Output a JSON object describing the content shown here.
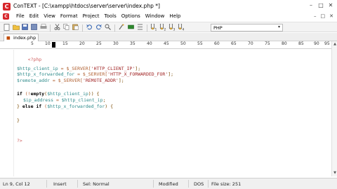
{
  "window": {
    "app_icon_letter": "C",
    "title": "ConTEXT - [C:\\xampp\\htdocs\\server\\server\\index.php *]",
    "controls": [
      "–",
      "□",
      "✕"
    ]
  },
  "menubar": {
    "items": [
      "File",
      "Edit",
      "View",
      "Format",
      "Project",
      "Tools",
      "Options",
      "Window",
      "Help"
    ],
    "doc_controls": [
      "–",
      "□",
      "✕"
    ]
  },
  "toolbar": {
    "language_value": "PHP",
    "language_arrow": "▾"
  },
  "tab": {
    "label": "index.php *"
  },
  "ruler": {
    "labels": [
      "5",
      "10",
      "15",
      "20",
      "25",
      "30",
      "35",
      "40",
      "45",
      "50",
      "55",
      "60",
      "65",
      "70",
      "75",
      "80",
      "85",
      "90",
      "95"
    ]
  },
  "code": {
    "l1": "<?php",
    "l3_var": "$http_client_ip",
    "l3_mid": " = $_SERVER[",
    "l3_str": "'HTTP_CLIENT_IP'",
    "l3_end": "];",
    "l4_var": "$http_x_forwarded_for",
    "l4_mid": " = $_SERVER[",
    "l4_str": "'HTTP_X_FORWARDED_FOR'",
    "l4_end": "];",
    "l5_var": "$remote_addr",
    "l5_mid": " = $_SERVER[",
    "l5_str": "'REMOTE_ADDR'",
    "l5_end": "];",
    "l7_kw": "if",
    "l7_mid": " (!",
    "l7_kw2": "empty",
    "l7_open": "(",
    "l7_var": "$http_client_ip",
    "l7_end": ")) {",
    "l8_var": "$ip_address",
    "l8_mid": " = ",
    "l8_var2": "$http_client_ip",
    "l8_end": ";",
    "l9_open": "} ",
    "l9_kw": "else if",
    "l9_mid": " (",
    "l9_var": "$http_x_forwarded_for",
    "l9_end": ") {",
    "l11": "}",
    "l14": "?>"
  },
  "statusbar": {
    "position": "Ln 9, Col 12",
    "mode": "Insert",
    "selection": "Sel: Normal",
    "modified": "Modified",
    "format": "DOS",
    "file_size": "File size: 251"
  }
}
